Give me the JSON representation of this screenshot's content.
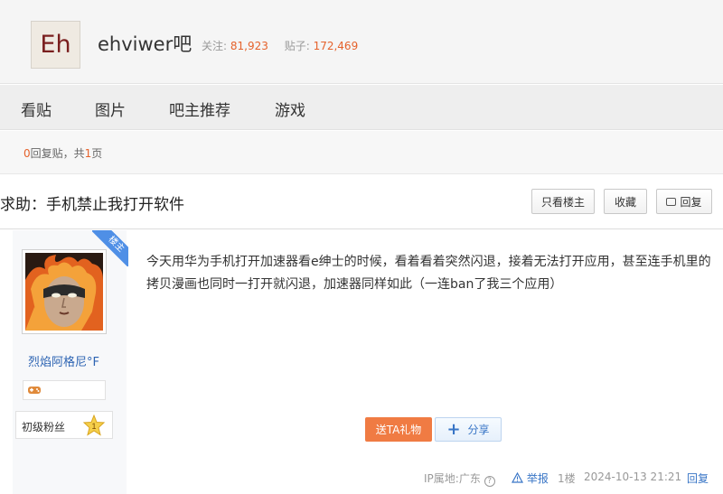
{
  "forum": {
    "logo_text": "Eh",
    "name": "ehviwer吧",
    "follow_label": "关注:",
    "follow_count": "81,923",
    "posts_label": "贴子:",
    "posts_count": "172,469"
  },
  "nav": {
    "tabs": [
      {
        "label": "看贴"
      },
      {
        "label": "图片"
      },
      {
        "label": "吧主推荐"
      },
      {
        "label": "游戏"
      }
    ]
  },
  "count_bar": {
    "reply_count": "0",
    "reply_label": "回复贴，共",
    "page_count": "1",
    "page_label": "页"
  },
  "thread": {
    "title": "求助：手机禁止我打开软件",
    "only_op_label": "只看楼主",
    "favorite_label": "收藏",
    "reply_label": "回复"
  },
  "post": {
    "badge": "楼主",
    "author": "烈焰阿格尼°F",
    "rank_label": "初级粉丝",
    "rank_level": "1",
    "content": "今天用华为手机打开加速器看e绅士的时候，看着看着突然闪退，接着无法打开应用，甚至连手机里的拷贝漫画也同时一打开就闪退，加速器同样如此（一连ban了我三个应用）",
    "gift_label": "送TA礼物",
    "share_label": "分享",
    "ip_label": "IP属地:广东",
    "report_label": "举报",
    "floor": "1楼",
    "timestamp": "2024-10-13 21:21",
    "reply_label": "回复"
  },
  "colors": {
    "accent_orange": "#e5622c",
    "link_blue": "#3875c6",
    "badge_blue": "#4f8fe6"
  },
  "icons": [
    "question-icon",
    "warning-icon",
    "reply-icon",
    "plus-icon",
    "gamepad-icon",
    "star-level-icon"
  ]
}
